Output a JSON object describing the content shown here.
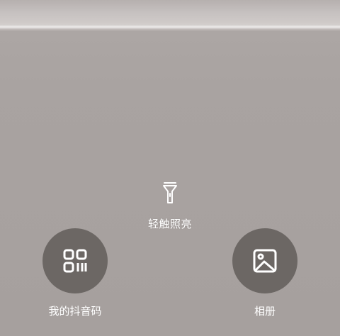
{
  "scanner": {
    "torch_label": "轻触照亮",
    "my_code_label": "我的抖音码",
    "album_label": "相册"
  },
  "icons": {
    "torch": "flashlight-icon",
    "my_code": "qr-code-icon",
    "album": "image-icon"
  },
  "colors": {
    "background": "#a9a3a1",
    "button_background": "#6c6764",
    "text": "#ffffff"
  }
}
